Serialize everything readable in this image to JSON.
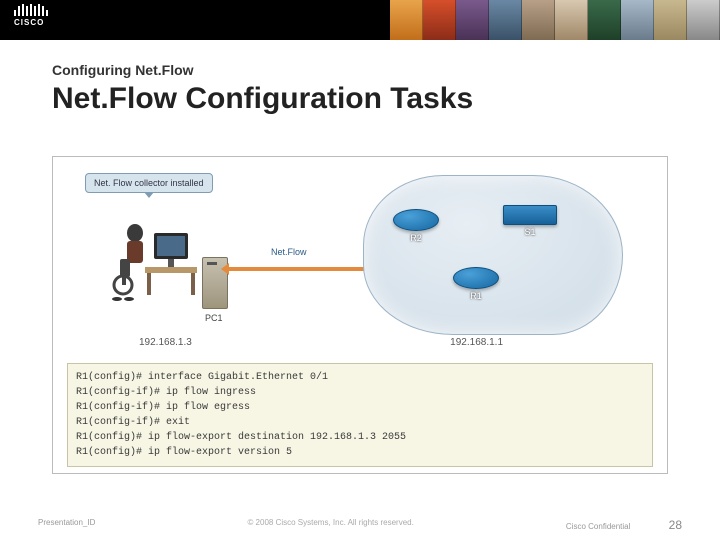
{
  "header": {
    "logo_text": "CISCO"
  },
  "subtitle": "Configuring Net.Flow",
  "title": "Net.Flow Configuration Tasks",
  "diagram": {
    "callout": "Net. Flow collector installed",
    "pc_label": "PC1",
    "pc_ip": "192.168.1.3",
    "flow_label": "Net.Flow",
    "devices": {
      "r1": "R1",
      "r2": "R2",
      "s1": "S1"
    },
    "net_ip": "192.168.1.1"
  },
  "cli": [
    "R1(config)# interface Gigabit.Ethernet 0/1",
    "R1(config-if)# ip flow ingress",
    "R1(config-if)# ip flow egress",
    "R1(config-if)# exit",
    "R1(config)# ip flow-export destination 192.168.1.3 2055",
    "R1(config)# ip flow-export version 5"
  ],
  "footer": {
    "left": "Presentation_ID",
    "center": "© 2008 Cisco Systems, Inc. All rights reserved.",
    "right": "Cisco Confidential",
    "page": "28"
  }
}
